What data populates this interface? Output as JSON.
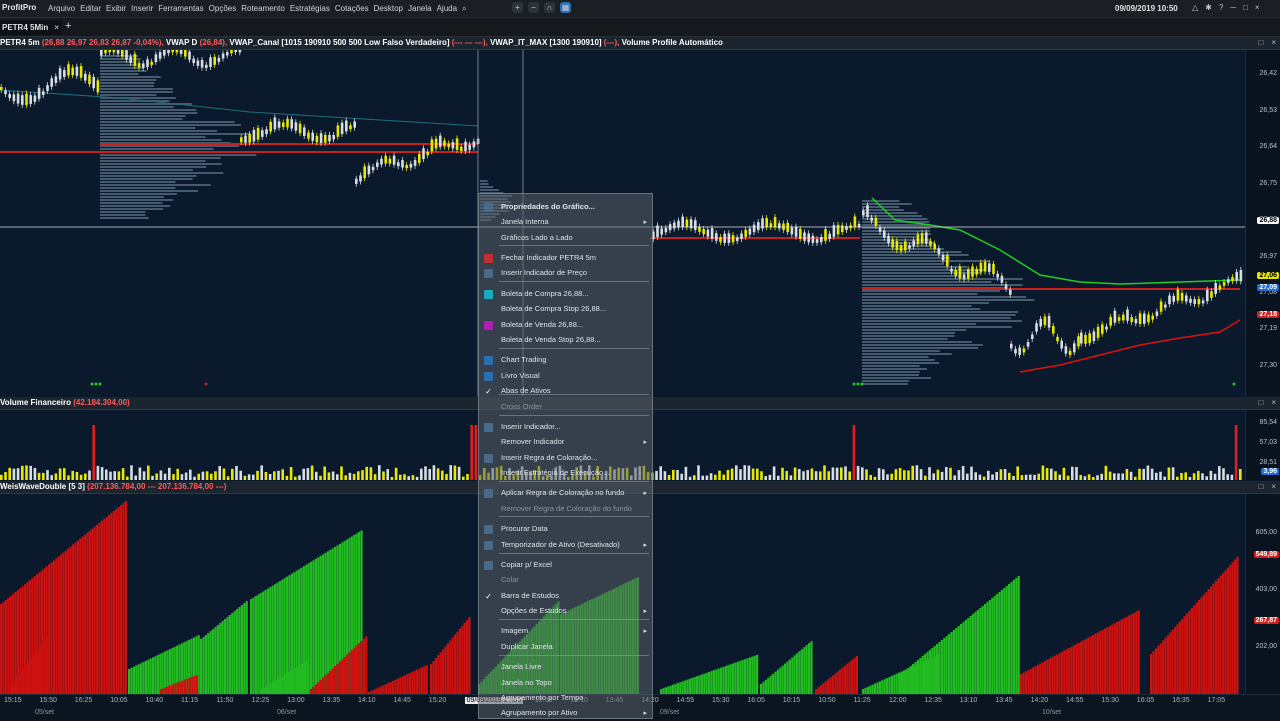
{
  "app": {
    "name": "ProfitPro",
    "datetime": "09/09/2019 10:50"
  },
  "menu": [
    "Arquivo",
    "Editar",
    "Exibir",
    "Inserir",
    "Ferramentas",
    "Opções",
    "Roteamento",
    "Estratégias",
    "Cotações",
    "Desktop",
    "Janela",
    "Ajuda"
  ],
  "tab": {
    "label": "PETR4 5Min",
    "close": "×",
    "add": "+"
  },
  "price_panel": {
    "header": {
      "symbol": "PETR4 5m",
      "quote": "(26,88  26,97  26,83  26,87  -0,04%),",
      "vwap_d": "VWAP D",
      "vwap_d_val": "(26,84),",
      "vwap_canal": "VWAP_Canal [1015 190910 500 500 Low Falso Verdadeiro]",
      "vwap_canal_val": "(--- --- ---),",
      "vwap_it": "VWAP_IT_MAX [1300 190910]",
      "vwap_it_val": "(---),",
      "vp": "Volume Profile Automático"
    },
    "ticks": [
      "26,42",
      "26,53",
      "26,64",
      "26,75",
      "26,86",
      "26,97",
      "27,08",
      "27,19",
      "27,30"
    ],
    "tags": [
      {
        "text": "26,88",
        "bg": "#ffffff",
        "fg": "#000000"
      },
      {
        "text": "27,06",
        "bg": "#e6e600",
        "fg": "#000000"
      },
      {
        "text": "27,09",
        "bg": "#1e6fd0",
        "fg": "#ffffff"
      },
      {
        "text": "27,18",
        "bg": "#d02020",
        "fg": "#ffffff"
      }
    ]
  },
  "volume_panel": {
    "header": {
      "name": "Volume Financeiro",
      "value": "(42.184.304,00)"
    },
    "ticks": [
      "85,54",
      "57,03",
      "28,51"
    ],
    "tag": "3,96"
  },
  "weis_panel": {
    "header": {
      "name": "WeisWaveDouble [5 3]",
      "value": "(207.136.784,00 --- 207.136.784,00 ---)"
    },
    "ticks": [
      "605,00",
      "403,00",
      "202,00"
    ],
    "tags": [
      {
        "text": "549,89",
        "bg": "#d02020"
      },
      {
        "text": "267,87",
        "bg": "#d02020"
      }
    ]
  },
  "xaxis": {
    "times": [
      "15:15",
      "15:50",
      "16:25",
      "10:05",
      "10:40",
      "11:15",
      "11:50",
      "12:25",
      "13:00",
      "13:35",
      "14:10",
      "14:45",
      "15:20",
      "15:55",
      "09/09/2019 17:30",
      "12:35",
      "13:10",
      "13:45",
      "14:20",
      "14:55",
      "15:30",
      "16:05",
      "10:15",
      "10:50",
      "11:25",
      "12:00",
      "12:35",
      "13:10",
      "13:45",
      "14:20",
      "14:55",
      "15:30",
      "16:05",
      "16:35",
      "17:05"
    ],
    "dates": [
      "05/set",
      "06/set",
      "09/set",
      "10/set"
    ]
  },
  "window_controls": [
    "─",
    "□",
    "×"
  ],
  "context_menu": {
    "items": [
      {
        "label": "Propriedades do Gráfico...",
        "bold": true,
        "icon": "properties-icon"
      },
      {
        "label": "Janela Interna",
        "sub": true
      },
      {
        "label": "Gráficos Lado a Lado"
      },
      {
        "label": "Fechar Indicador PETR4 5m",
        "icon": "close-icon"
      },
      {
        "label": "Inserir Indicador de Preço",
        "icon": "indicator-icon"
      },
      {
        "label": "Boleta de Compra  26,88...",
        "icon": "buy-icon"
      },
      {
        "label": "Boleta de Compra Stop  26,88..."
      },
      {
        "label": "Boleta de Venda  26,88...",
        "icon": "sell-icon"
      },
      {
        "label": "Boleta de Venda Stop  26,88..."
      },
      {
        "label": "Chart Trading",
        "icon": "chart-trading-icon"
      },
      {
        "label": "Livro Visual",
        "icon": "book-icon"
      },
      {
        "label": "Abas de Ativos",
        "check": true
      },
      {
        "label": "Cross Order",
        "disabled": true
      },
      {
        "label": "Inserir Indicador...",
        "icon": "insert-indicator-icon"
      },
      {
        "label": "Remover Indicador",
        "sub": true
      },
      {
        "label": "Inserir Regra de Coloração...",
        "icon": "color-rule-icon"
      },
      {
        "label": "Inserir Estratégia de Execução..."
      },
      {
        "label": "Aplicar Regra de Coloração no fundo",
        "sub": true,
        "icon": "bg-color-icon"
      },
      {
        "label": "Remover Regra de Coloração do fundo",
        "disabled": true
      },
      {
        "label": "Procurar Data",
        "icon": "search-date-icon"
      },
      {
        "label": "Temporizador de Ativo (Desativado)",
        "sub": true,
        "icon": "timer-icon"
      },
      {
        "label": "Copiar p/ Excel",
        "icon": "copy-icon"
      },
      {
        "label": "Colar",
        "disabled": true
      },
      {
        "label": "Barra de Estudos",
        "check": true
      },
      {
        "label": "Opções de Estudos",
        "sub": true
      },
      {
        "label": "Imagem",
        "sub": true
      },
      {
        "label": "Duplicar Janela"
      },
      {
        "label": "Janela Livre"
      },
      {
        "label": "Janela no Topo"
      },
      {
        "label": "Agrupamento por Tempo"
      },
      {
        "label": "Agrupamento por Ativo",
        "sub": true
      }
    ]
  },
  "colors": {
    "bg": "#0a1a2c",
    "up": "#e8e800",
    "down": "#d8dde4",
    "vwap": "#c62020",
    "green_line": "#22cc22",
    "red_line": "#dd1111",
    "weis_up": "#22bb22",
    "weis_down": "#cc1111"
  }
}
